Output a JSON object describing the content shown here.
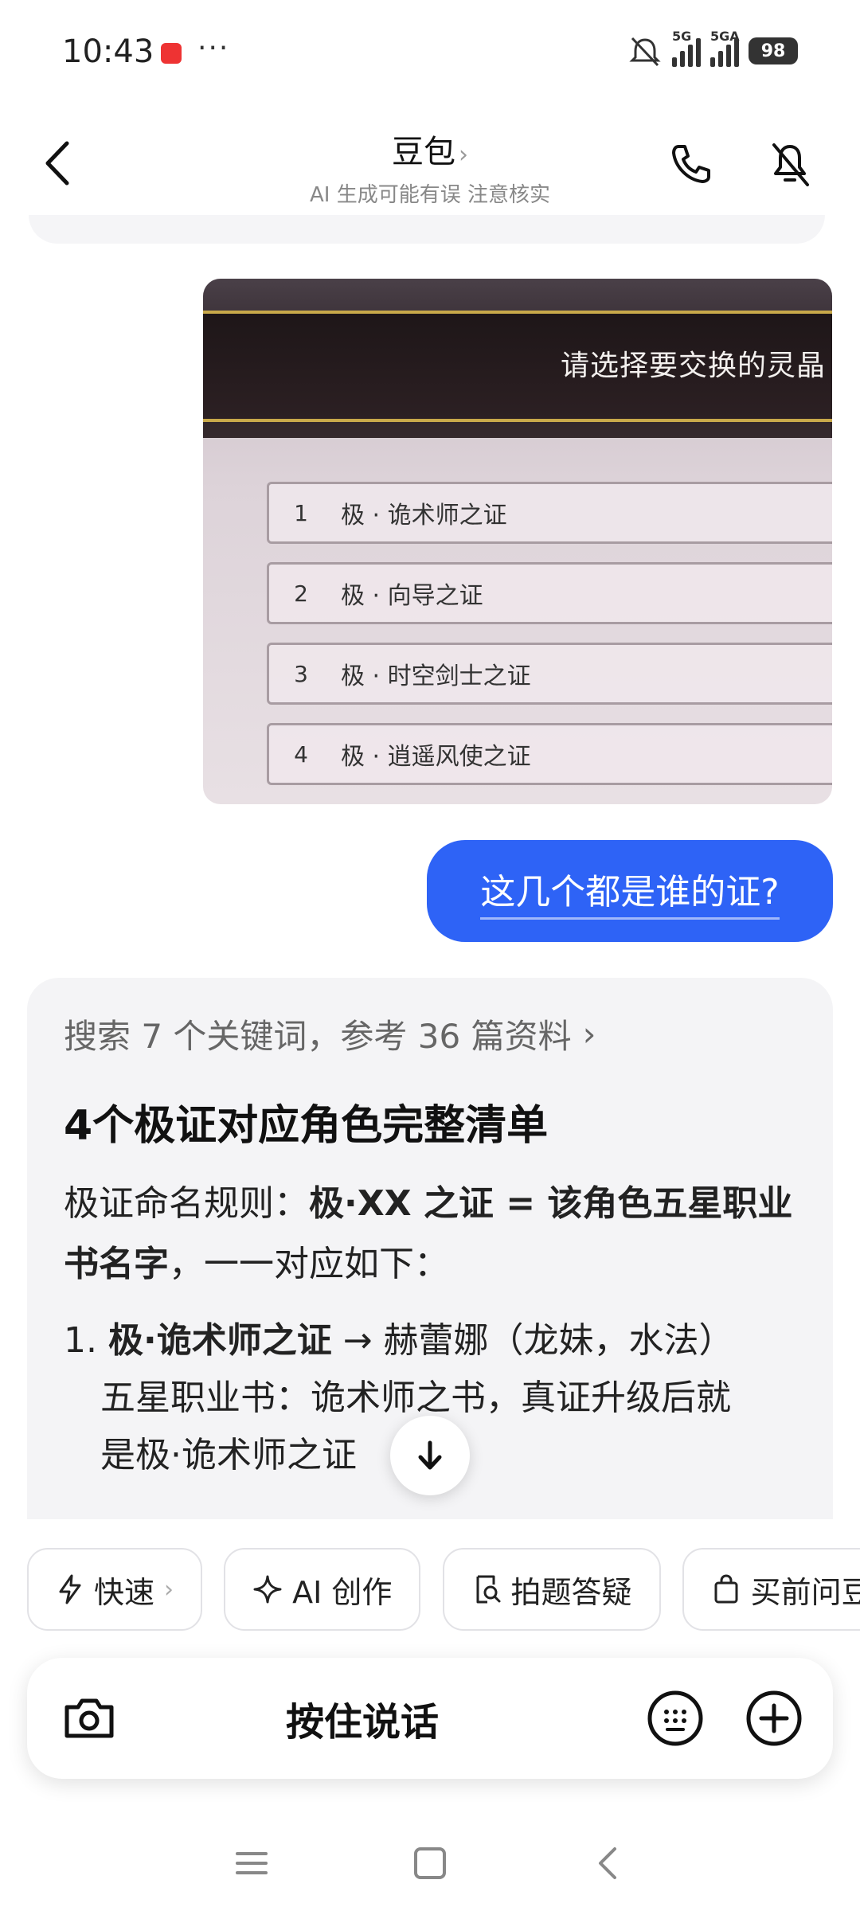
{
  "status": {
    "time": "10:43",
    "dots": "···",
    "signal1_label": "5G",
    "signal2_label": "5GA",
    "battery": "98"
  },
  "header": {
    "title": "豆包",
    "chevron": "›",
    "subtitle": "AI 生成可能有误 注意核实"
  },
  "user_image": {
    "banner": "请选择要交换的灵晶",
    "rows": [
      {
        "num": "1",
        "text": "极 · 诡术师之证"
      },
      {
        "num": "2",
        "text": "极 · 向导之证"
      },
      {
        "num": "3",
        "text": "极 · 时空剑士之证"
      },
      {
        "num": "4",
        "text": "极 · 逍遥风使之证"
      }
    ]
  },
  "user_message": "这几个都是谁的证?",
  "ai_reply": {
    "search_summary": "搜索 7 个关键词，参考 36 篇资料",
    "search_chevron": "›",
    "heading": "4个极证对应角色完整清单",
    "rule_prefix": "极证命名规则：",
    "rule_bold": "极·XX 之证 = 该角色五星职业书名字",
    "rule_suffix": "，一一对应如下：",
    "item1_num": "1.",
    "item1_bold": "极·诡术师之证",
    "item1_rest": " → 赫蕾娜（龙妹，水法）",
    "item1_line2": "五星职业书：诡术师之书，真证升级后就",
    "item1_line3": "是极·诡术师之证"
  },
  "chips": [
    {
      "label": "快速",
      "icon": "lightning-icon",
      "has_chevron": true
    },
    {
      "label": "AI 创作",
      "icon": "sparkle-icon"
    },
    {
      "label": "拍题答疑",
      "icon": "search-doc-icon"
    },
    {
      "label": "买前问豆",
      "icon": "shopping-bag-icon"
    }
  ],
  "input_bar": {
    "hold_to_talk": "按住说话"
  },
  "colors": {
    "accent": "#2e63f6",
    "card_bg": "#f4f4f6"
  }
}
